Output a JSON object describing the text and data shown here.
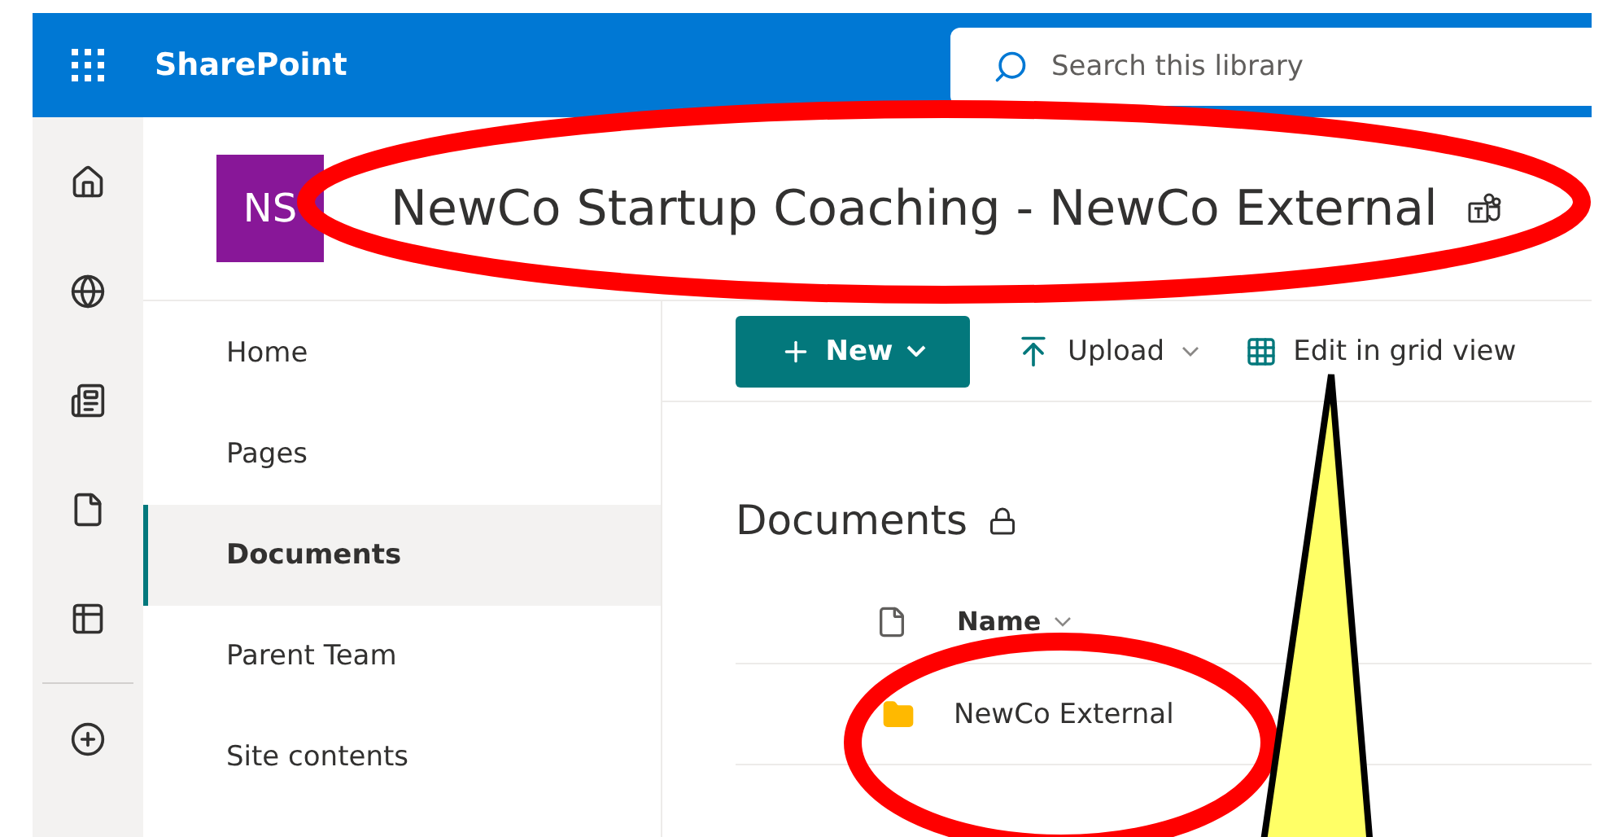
{
  "app": {
    "name": "SharePoint"
  },
  "search": {
    "placeholder": "Search this library"
  },
  "site": {
    "logo": "NS",
    "title": "NewCo Startup Coaching - NewCo External"
  },
  "nav": [
    {
      "label": "Home",
      "selected": false
    },
    {
      "label": "Pages",
      "selected": false
    },
    {
      "label": "Documents",
      "selected": true
    },
    {
      "label": "Parent Team",
      "selected": false
    },
    {
      "label": "Site contents",
      "selected": false
    }
  ],
  "commands": [
    {
      "label": "New",
      "kind": "primary"
    },
    {
      "label": "Upload",
      "kind": "upload"
    },
    {
      "label": "Edit in grid view",
      "kind": "grid"
    }
  ],
  "library": {
    "title": "Documents",
    "columns": [
      "Name"
    ],
    "rows": [
      {
        "name": "NewCo External",
        "kind": "folder"
      }
    ]
  }
}
